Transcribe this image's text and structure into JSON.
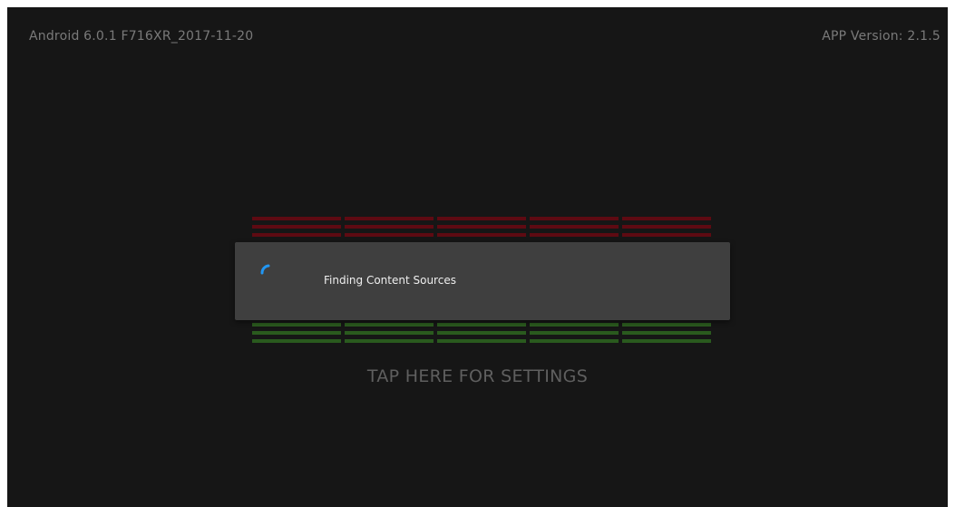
{
  "status_bar": {
    "os_version": "Android 6.0.1 F716XR_2017-11-20",
    "app_version": "APP Version: 2.1.5"
  },
  "settings_link": "TAP HERE FOR SETTINGS",
  "dialog": {
    "message": "Finding Content Sources",
    "spinner_icon": "loading-spinner-icon"
  },
  "colors": {
    "background": "#161616",
    "dialog_background": "#3f3f3f",
    "bar_red": "#5e0a12",
    "bar_green": "#2a5a1e",
    "spinner": "#2196f3"
  }
}
